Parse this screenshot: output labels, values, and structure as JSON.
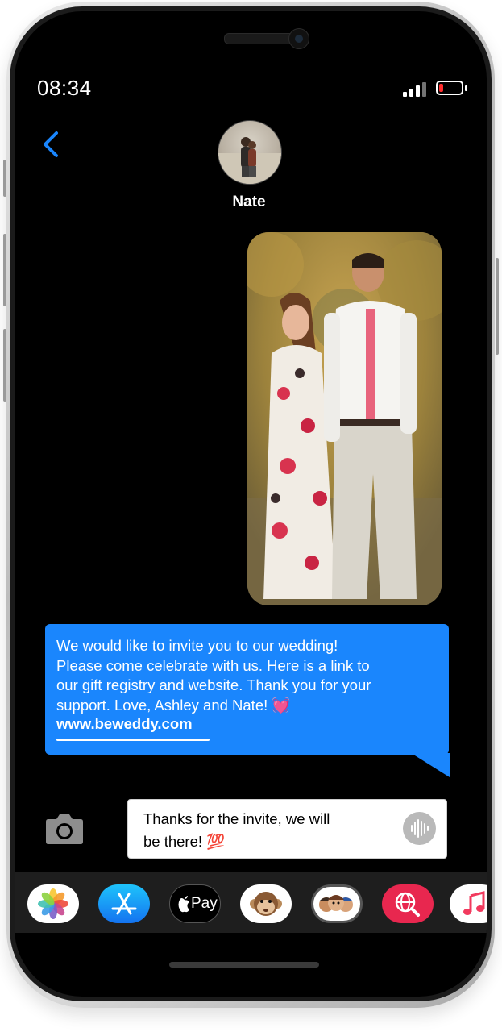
{
  "status_bar": {
    "time": "08:34",
    "battery_level": 0.2,
    "battery_color": "#ff2d2d"
  },
  "header": {
    "back_icon": "chevron-left-icon",
    "contact_name": "Nate",
    "accent_color": "#1a86fd"
  },
  "conversation": {
    "photo_description_icon": "couple-photo",
    "sent_message": {
      "lines": [
        "We would like to invite you to our wedding!",
        "Please come celebrate with us. Here is a link to",
        "our gift registry and website. Thank you for your",
        "support. Love, Ashley and Nate!"
      ],
      "heart_emoji": "💓",
      "link": "www.beweddy.com",
      "bubble_color": "#1a86fd"
    }
  },
  "composer": {
    "camera_icon": "camera-icon",
    "text_line1": "Thanks for the invite, we will",
    "text_line2": "be there!",
    "emoji": "💯",
    "mic_icon": "audio-waveform-icon"
  },
  "app_drawer": {
    "apps": [
      {
        "name": "photos",
        "icon": "photos-icon"
      },
      {
        "name": "app-store",
        "icon": "app-store-icon"
      },
      {
        "name": "apple-pay",
        "label": "Pay",
        "icon": "apple-pay-icon"
      },
      {
        "name": "animoji",
        "icon": "monkey-animoji-icon"
      },
      {
        "name": "memoji-stickers",
        "icon": "memoji-stickers-icon"
      },
      {
        "name": "web-search",
        "icon": "globe-search-icon"
      },
      {
        "name": "music",
        "icon": "music-note-icon"
      }
    ]
  }
}
